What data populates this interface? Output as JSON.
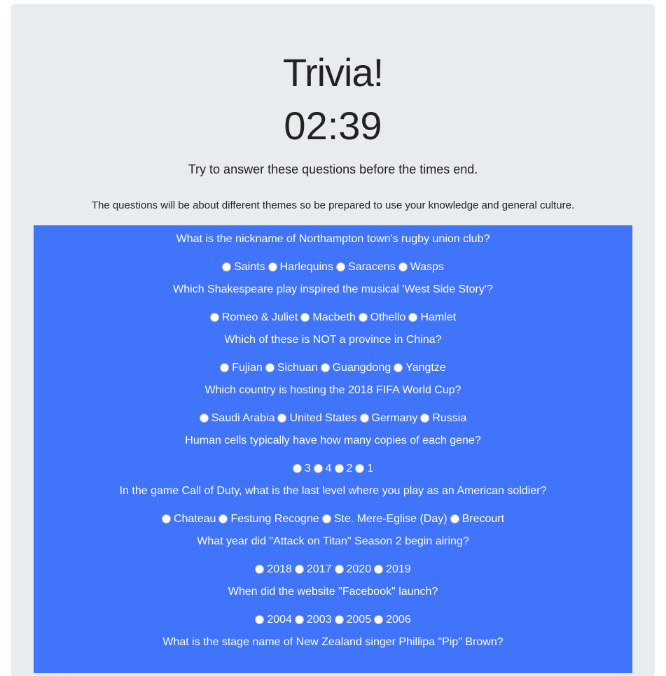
{
  "header": {
    "title": "Trivia!",
    "timer": "02:39",
    "lead": "Try to answer these questions before the times end.",
    "subtitle": "The questions will be about different themes so be prepared to use your knowledge and general culture."
  },
  "quiz": {
    "questions": [
      {
        "text": "What is the nickname of Northampton town's rugby union club?",
        "options": [
          "Saints",
          "Harlequins",
          "Saracens",
          "Wasps"
        ]
      },
      {
        "text": "Which Shakespeare play inspired the musical 'West Side Story'?",
        "options": [
          "Romeo & Juliet",
          "Macbeth",
          "Othello",
          "Hamlet"
        ]
      },
      {
        "text": "Which of these is NOT a province in China?",
        "options": [
          "Fujian",
          "Sichuan",
          "Guangdong",
          "Yangtze"
        ]
      },
      {
        "text": "Which country is hosting the 2018 FIFA World Cup?",
        "options": [
          "Saudi Arabia",
          "United States",
          "Germany",
          "Russia"
        ]
      },
      {
        "text": "Human cells typically have how many copies of each gene?",
        "options": [
          "3",
          "4",
          "2",
          "1"
        ]
      },
      {
        "text": "In the game Call of Duty, what is the last level where you play as an American soldier?",
        "options": [
          "Chateau",
          "Festung Recogne",
          "Ste. Mere-Eglise (Day)",
          "Brecourt"
        ]
      },
      {
        "text": "What year did \"Attack on Titan\" Season 2 begin airing?",
        "options": [
          "2018",
          "2017",
          "2020",
          "2019"
        ]
      },
      {
        "text": "When did the website \"Facebook\" launch?",
        "options": [
          "2004",
          "2003",
          "2005",
          "2006"
        ]
      },
      {
        "text": "What is the stage name of New Zealand singer Phillipa \"Pip\" Brown?",
        "options": []
      }
    ]
  },
  "colors": {
    "background": "#e9ecef",
    "quiz_panel": "#3f74fb",
    "text_light": "#ffffff"
  }
}
